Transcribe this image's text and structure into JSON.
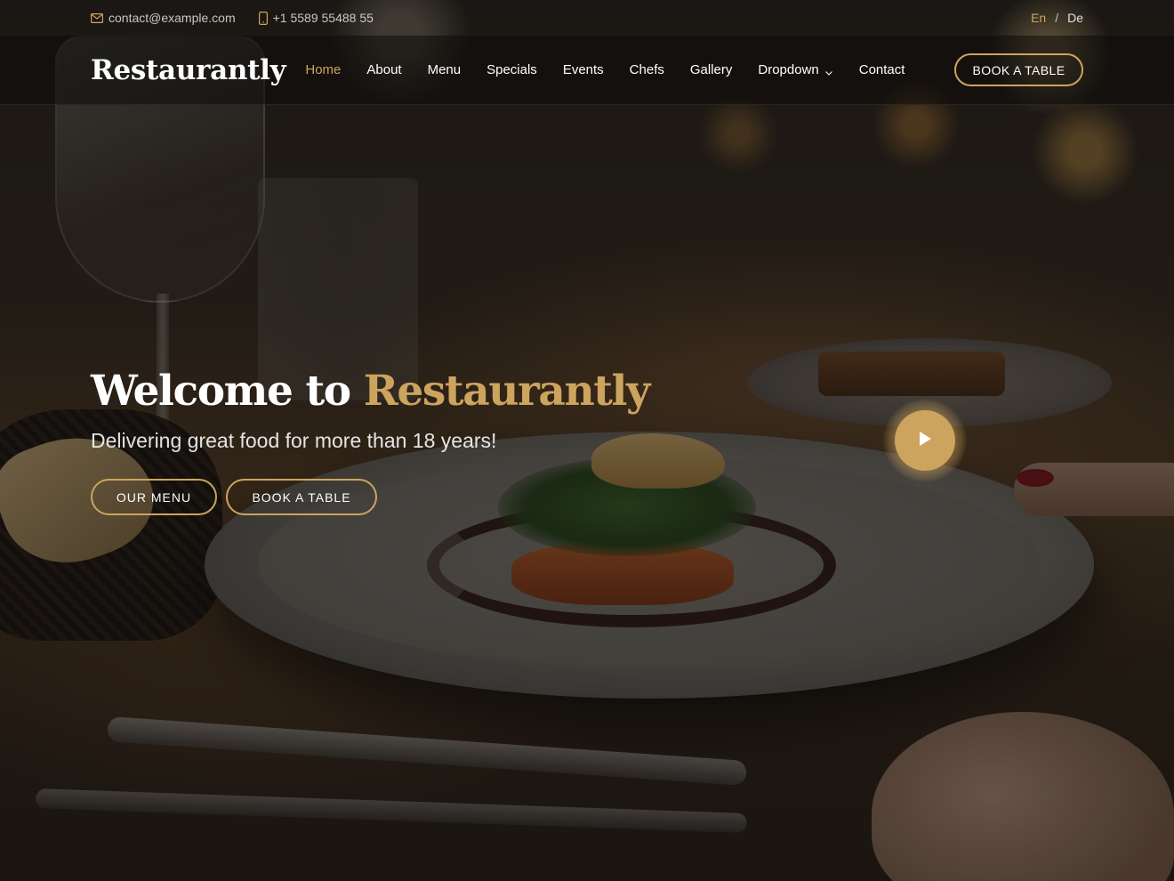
{
  "topbar": {
    "email": "contact@example.com",
    "phone": "+1 5589 55488 55",
    "lang_active": "En",
    "lang_separator": "/",
    "lang_other": "De"
  },
  "header": {
    "logo": "Restaurantly",
    "nav": {
      "home": "Home",
      "about": "About",
      "menu": "Menu",
      "specials": "Specials",
      "events": "Events",
      "chefs": "Chefs",
      "gallery": "Gallery",
      "dropdown": "Dropdown",
      "contact": "Contact"
    },
    "active_item": "Home",
    "cta": "BOOK A TABLE"
  },
  "hero": {
    "title_prefix": "Welcome to",
    "title_accent": "Restaurantly",
    "subtitle": "Delivering great food for more than 18 years!",
    "menu_button": "OUR MENU",
    "book_button": "BOOK A TABLE"
  },
  "icons": {
    "email": "envelope-icon",
    "phone": "phone-icon",
    "dropdown": "chevron-down-icon",
    "video": "play-icon"
  },
  "colors": {
    "accent": "#cda45e",
    "text": "#ffffff"
  }
}
